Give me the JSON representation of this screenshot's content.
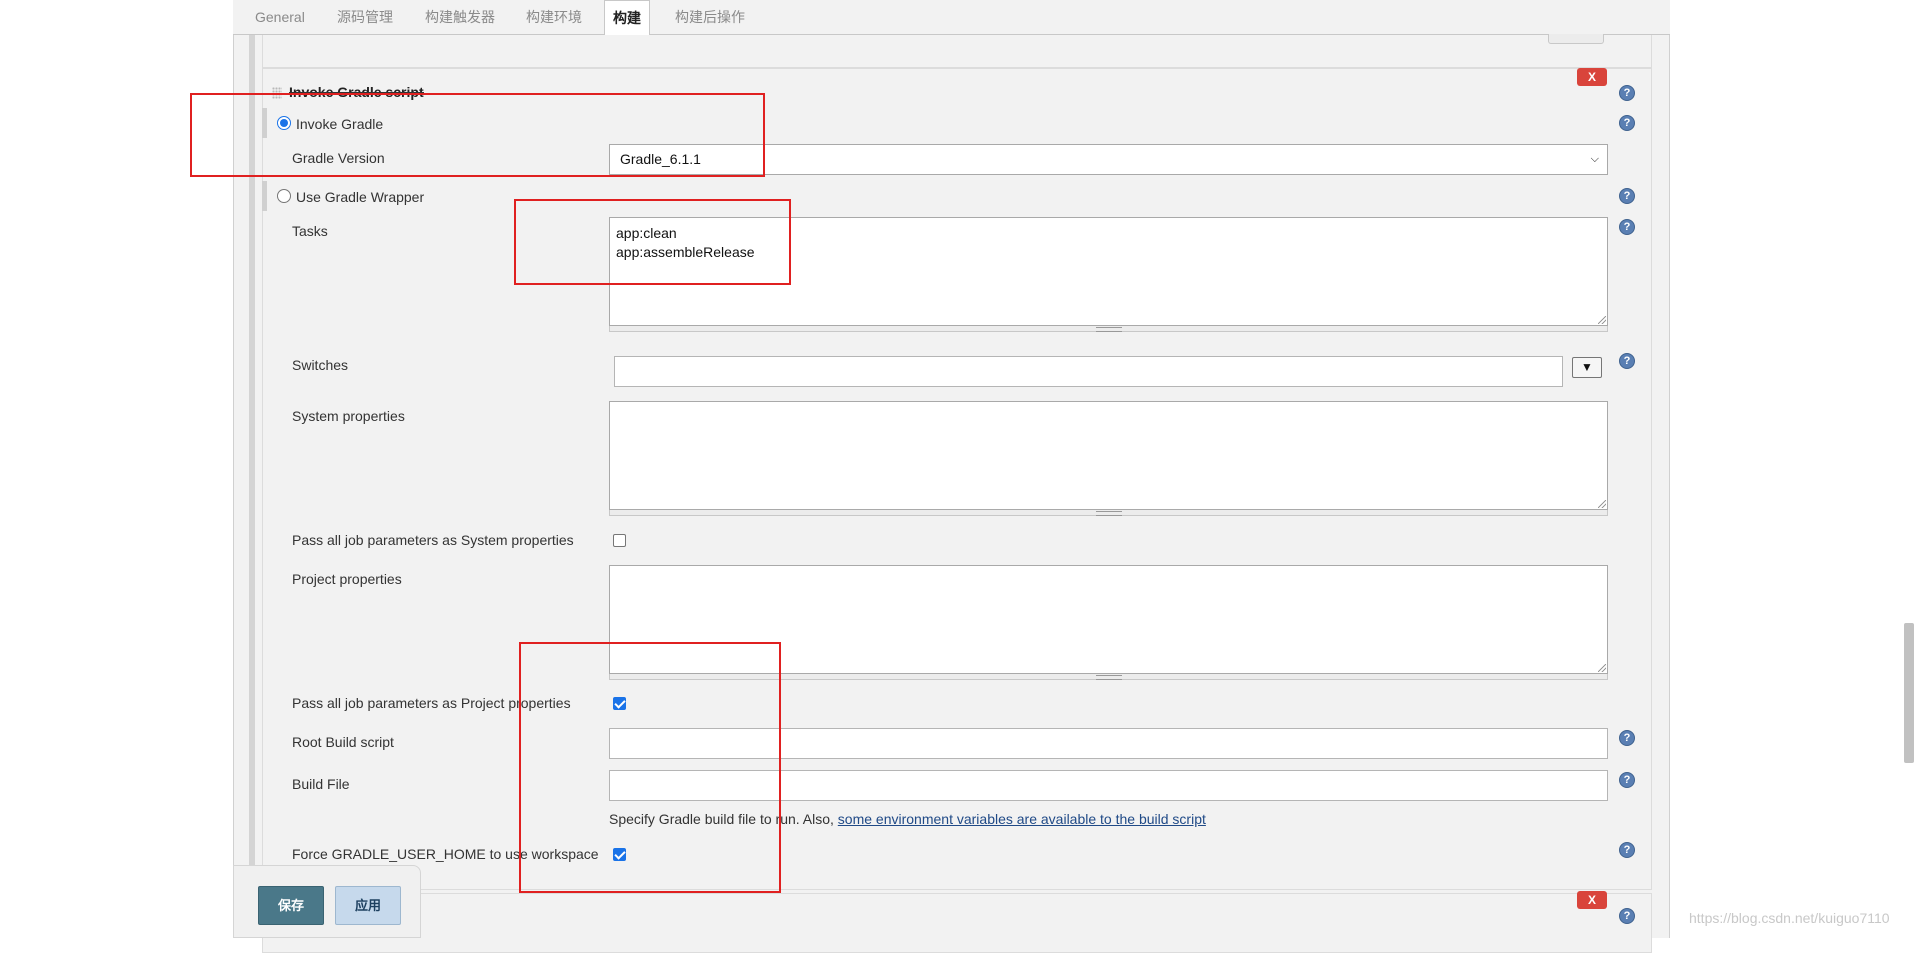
{
  "tabs": [
    {
      "label": "General"
    },
    {
      "label": "源码管理"
    },
    {
      "label": "构建触发器"
    },
    {
      "label": "构建环境"
    },
    {
      "label": "构建"
    },
    {
      "label": "构建后操作"
    }
  ],
  "section": {
    "title": "Invoke Gradle script",
    "delete_label": "X"
  },
  "invoke_gradle": {
    "label": "Invoke Gradle",
    "selected": true,
    "gradle_version_label": "Gradle Version",
    "gradle_version_value": "Gradle_6.1.1"
  },
  "use_wrapper": {
    "label": "Use Gradle Wrapper",
    "selected": false
  },
  "tasks": {
    "label": "Tasks",
    "lines": [
      "app:clean",
      "app:assembleRelease"
    ]
  },
  "switches": {
    "label": "Switches",
    "value": "",
    "dropdown_glyph": "▼"
  },
  "system_properties": {
    "label": "System properties",
    "value": ""
  },
  "pass_system": {
    "label": "Pass all job parameters as System properties",
    "checked": false
  },
  "project_properties": {
    "label": "Project properties",
    "value": ""
  },
  "pass_project": {
    "label": "Pass all job parameters as Project properties",
    "checked": true
  },
  "root_build_script": {
    "label": "Root Build script",
    "value": ""
  },
  "build_file": {
    "label": "Build File",
    "value": "",
    "hint_prefix": "Specify Gradle build file to run. Also, ",
    "hint_link": "some environment variables are available to the build script"
  },
  "force_home": {
    "label": "Force GRADLE_USER_HOME to use workspace",
    "checked": true
  },
  "next_section": {
    "delete_label": "X"
  },
  "footer": {
    "save_label": "保存",
    "apply_label": "应用"
  },
  "watermark": "https://blog.csdn.net/kuiguo7110"
}
